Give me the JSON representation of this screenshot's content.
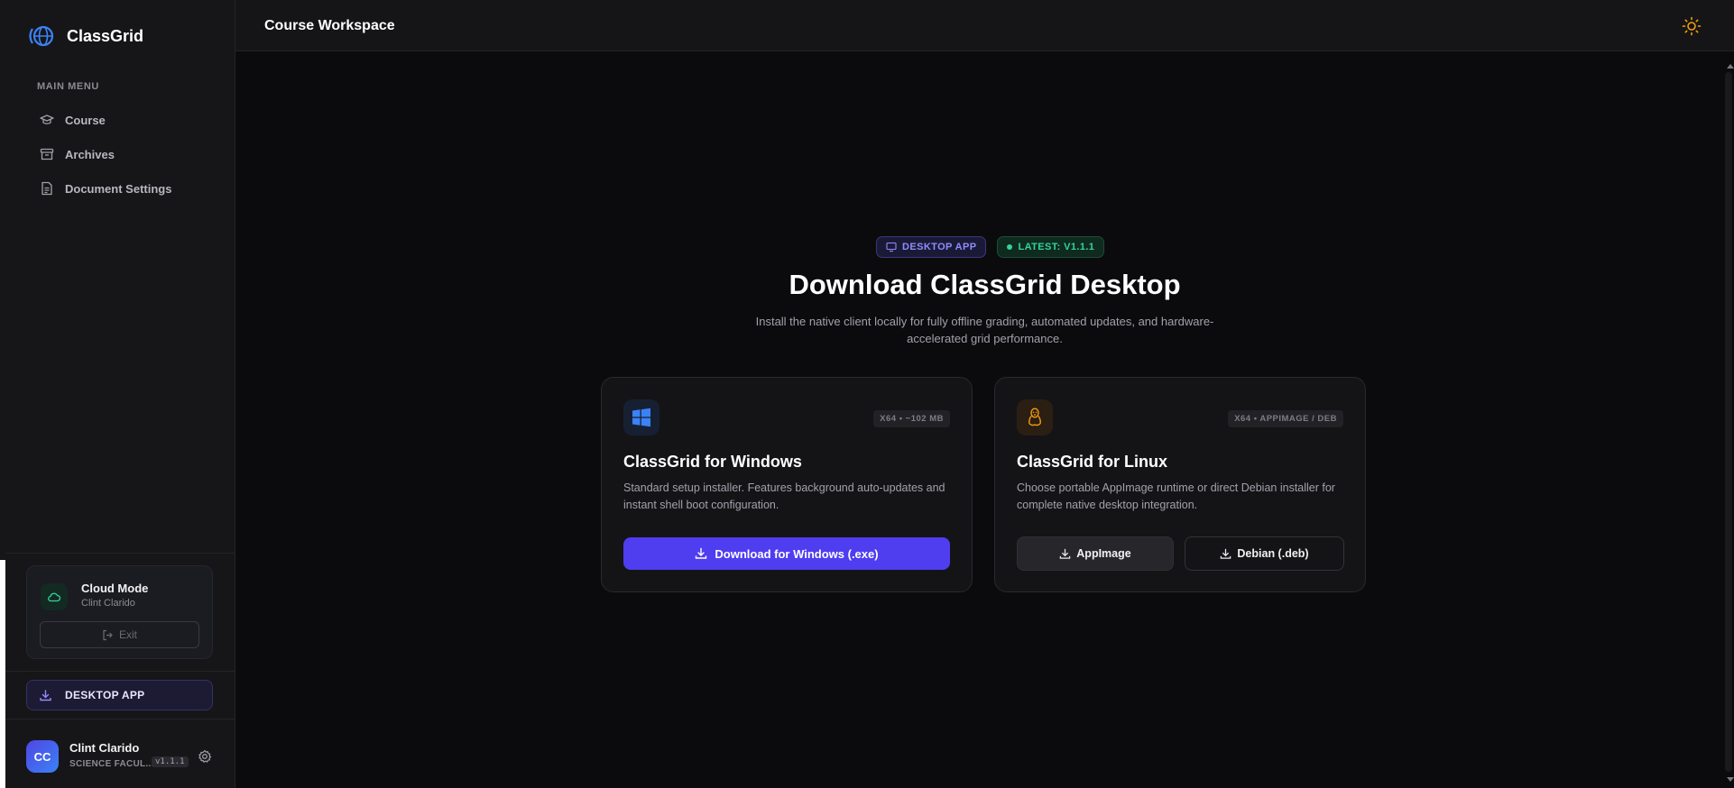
{
  "sidebar": {
    "brand": "ClassGrid",
    "menu_heading": "MAIN MENU",
    "items": [
      {
        "label": "Course",
        "icon": "graduation-cap-icon"
      },
      {
        "label": "Archives",
        "icon": "archive-icon"
      },
      {
        "label": "Document Settings",
        "icon": "document-icon"
      }
    ],
    "cloud": {
      "title": "Cloud Mode",
      "user": "Clint Clarido",
      "exit_label": "Exit"
    },
    "desktop_app_label": "DESKTOP APP",
    "user": {
      "initials": "CC",
      "name": "Clint Clarido",
      "role": "SCIENCE FACUL...",
      "version": "v1.1.1"
    }
  },
  "topbar": {
    "title": "Course Workspace"
  },
  "hero": {
    "badge_desktop": "DESKTOP APP",
    "badge_latest": "LATEST: V1.1.1",
    "title": "Download ClassGrid Desktop",
    "subtitle": "Install the native client locally for fully offline grading, automated updates, and hardware-accelerated grid performance."
  },
  "cards": {
    "windows": {
      "spec": "X64 • ~102 MB",
      "title": "ClassGrid for Windows",
      "description": "Standard setup installer. Features background auto-updates and instant shell boot configuration.",
      "button": "Download for Windows (.exe)"
    },
    "linux": {
      "spec": "X64 • APPIMAGE / DEB",
      "title": "ClassGrid for Linux",
      "description": "Choose portable AppImage runtime or direct Debian installer for complete native desktop integration.",
      "button_appimage": "AppImage",
      "button_deb": "Debian (.deb)"
    }
  },
  "colors": {
    "accent": "#4f3df0",
    "success": "#34d399",
    "background": "#0b0b0d",
    "sidebar": "#161618"
  }
}
